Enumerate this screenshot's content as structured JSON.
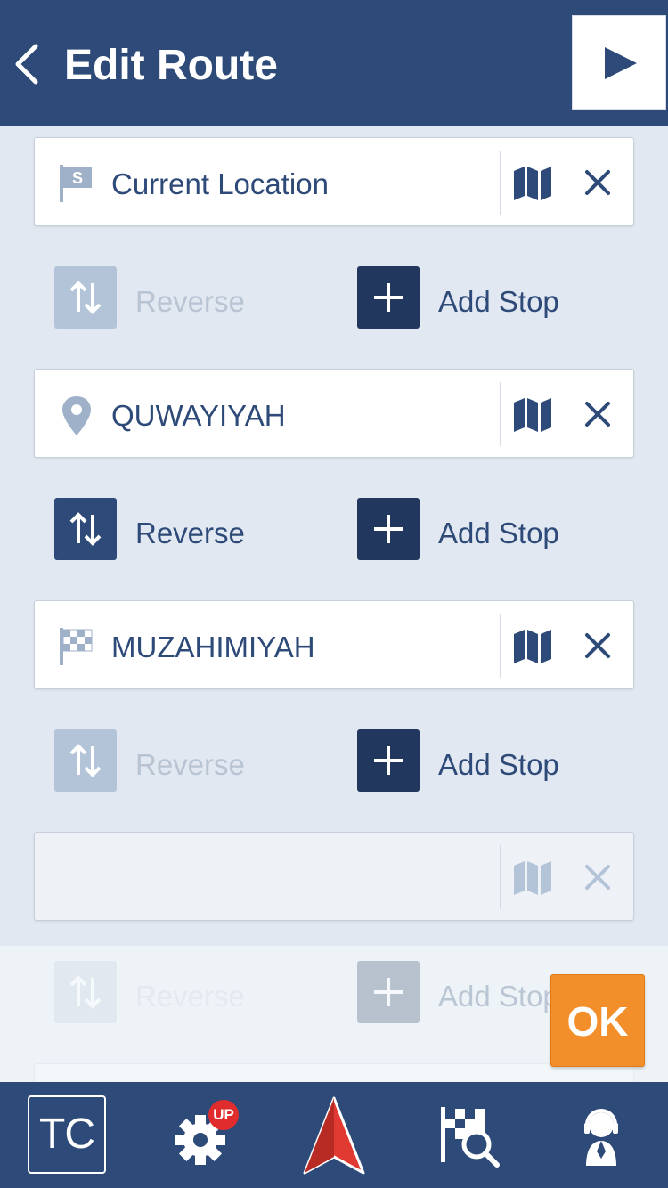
{
  "header": {
    "title": "Edit Route",
    "back_icon": "chevron-left-icon",
    "play_icon": "play-icon"
  },
  "stops": [
    {
      "label": "Current Location",
      "icon": "start-flag-icon",
      "icon_letter": "S",
      "empty": false
    },
    {
      "label": "QUWAYIYAH",
      "icon": "location-pin-icon",
      "empty": false
    },
    {
      "label": "MUZAHIMIYAH",
      "icon": "finish-flag-icon",
      "empty": false
    },
    {
      "label": "",
      "icon": "",
      "empty": true
    }
  ],
  "actions": {
    "reverse_label": "Reverse",
    "add_stop_label": "Add Stop",
    "reverse_enabled": [
      false,
      true,
      false,
      false
    ]
  },
  "ok_label": "OK",
  "bottom_bar": {
    "tc_label": "TC",
    "settings_badge": "UP"
  },
  "colors": {
    "primary": "#2d4a78",
    "ok_button": "#f38f2a",
    "badge": "#e02c2c",
    "nav_arrow": "#e03a32",
    "disabled": "#b3c3d8"
  }
}
